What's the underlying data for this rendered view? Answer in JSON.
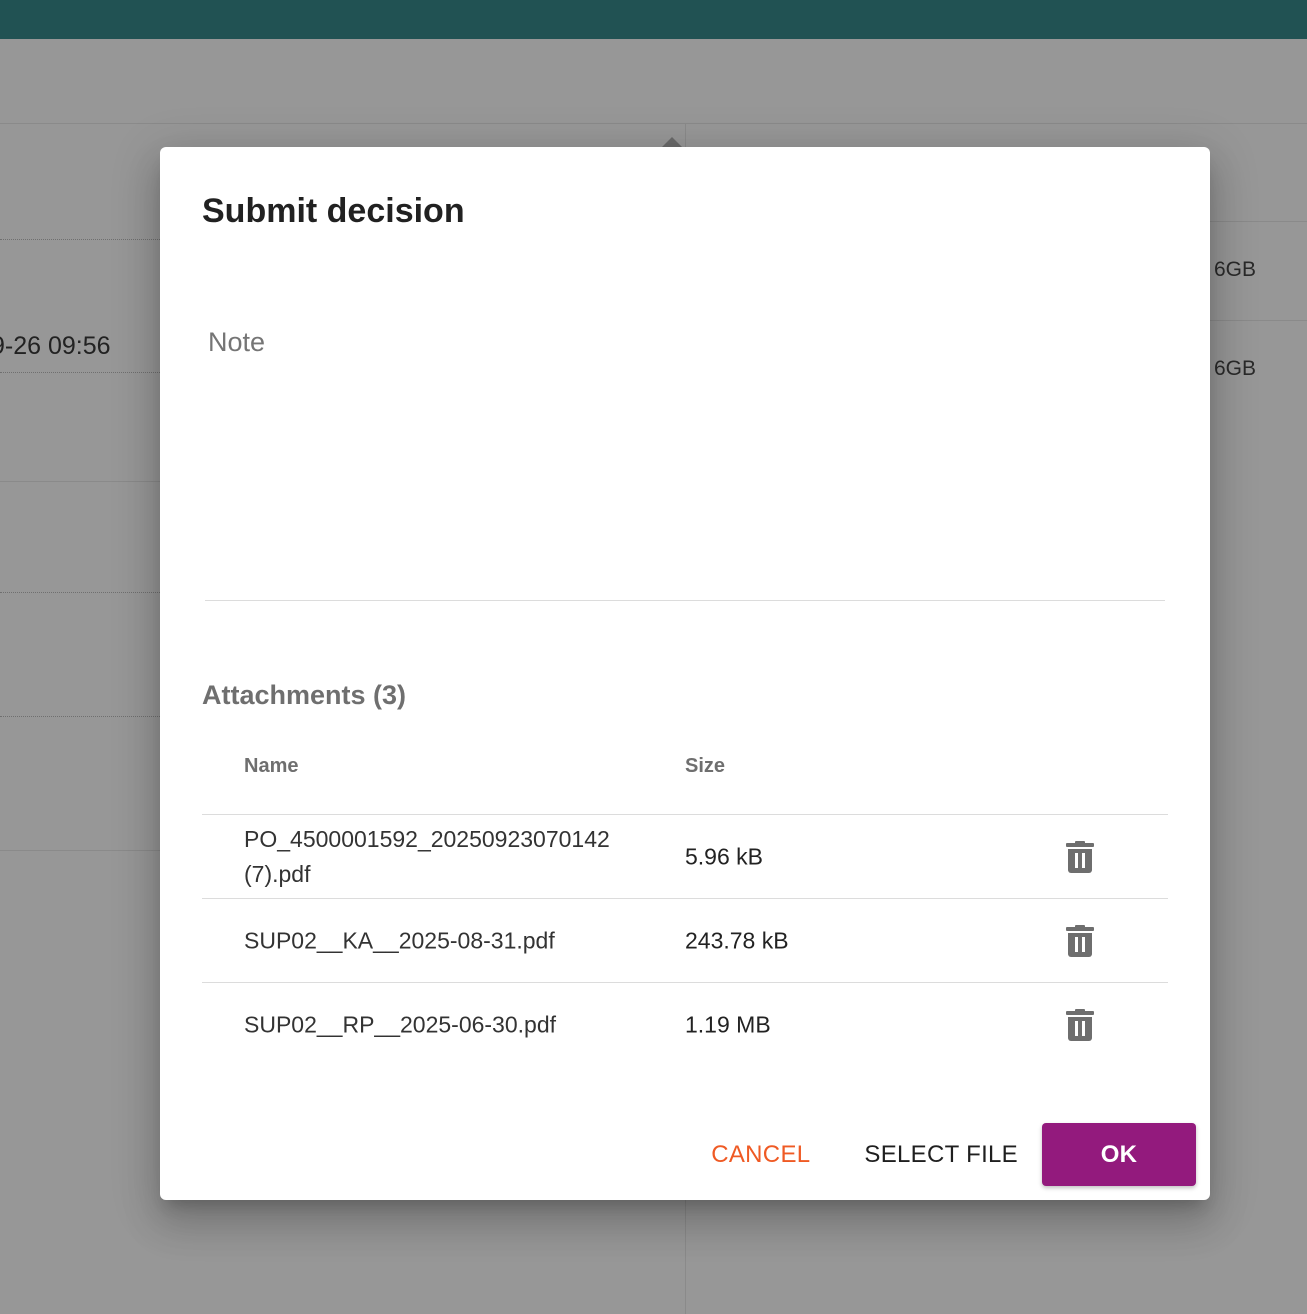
{
  "background": {
    "datetime_fragment": "9-26 09:56",
    "storage_values": [
      "6GB",
      "6GB"
    ]
  },
  "dialog": {
    "title": "Submit decision",
    "note": {
      "label": "Note",
      "value": ""
    },
    "attachments": {
      "heading": "Attachments (3)",
      "columns": {
        "name": "Name",
        "size": "Size"
      },
      "rows": [
        {
          "name": "PO_4500001592_20250923070142 (7).pdf",
          "size": "5.96 kB"
        },
        {
          "name": "SUP02__KA__2025-08-31.pdf",
          "size": "243.78 kB"
        },
        {
          "name": "SUP02__RP__2025-06-30.pdf",
          "size": "1.19 MB"
        }
      ],
      "row_action_icon": "trash-icon"
    },
    "actions": {
      "cancel": "CANCEL",
      "select_file": "SELECT FILE",
      "ok": "OK"
    }
  },
  "colors": {
    "topbar": "#215253",
    "cancel": "#ef5a24",
    "ok_button": "#931a7d",
    "overlay_gray": "#979797"
  }
}
